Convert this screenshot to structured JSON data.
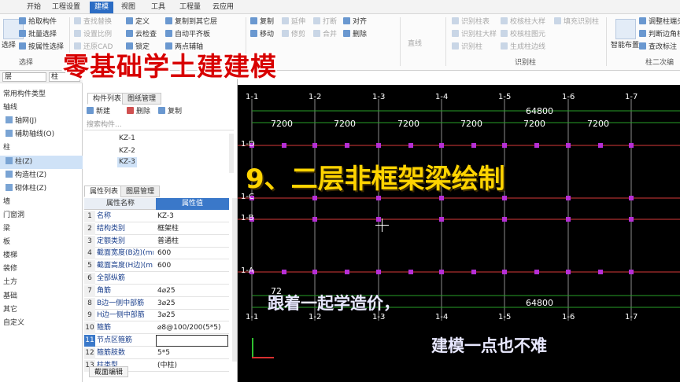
{
  "menu_tabs": [
    "开始",
    "工程设置",
    "建模",
    "视图",
    "工具",
    "工程量",
    "云应用"
  ],
  "active_tab": "建模",
  "ribbon": {
    "select_big": "选择",
    "select_items": [
      "拾取构件",
      "批量选择",
      "按属性选择"
    ],
    "select_group": "选择",
    "g2": [
      "查找替换",
      "设置比例",
      "还原CAD"
    ],
    "g3": [
      "定义",
      "云检查",
      "锁定"
    ],
    "g4": [
      "复制到其它层",
      "自动平齐板",
      "两点辅轴"
    ],
    "g5": [
      "复制",
      "移动"
    ],
    "g5b": [
      "延伸",
      "修剪"
    ],
    "g6": [
      "打断",
      "合并"
    ],
    "g7": [
      "对齐",
      "删除"
    ],
    "g8": [
      "直线"
    ],
    "g9": [
      "识别柱表",
      "识别柱大样",
      "识别柱"
    ],
    "g10": [
      "校核柱大样",
      "校核柱图元",
      "生成柱边线"
    ],
    "g11": [
      "填充识别柱"
    ],
    "recog_group": "识别柱",
    "smart": "智能布置",
    "g12": [
      "调整柱端头",
      "判断边角柱",
      "查改标注"
    ],
    "col2d_group": "柱二次编"
  },
  "layer_select": "层",
  "type_select": "柱",
  "left_panel": {
    "items": [
      {
        "label": "常用构件类型",
        "sub": false,
        "sel": false
      },
      {
        "label": "轴线",
        "sub": false,
        "sel": false
      },
      {
        "label": "轴网(J)",
        "sub": true,
        "sel": false
      },
      {
        "label": "辅助轴线(O)",
        "sub": true,
        "sel": false
      },
      {
        "label": "柱",
        "sub": false,
        "sel": false
      },
      {
        "label": "柱(Z)",
        "sub": true,
        "sel": true
      },
      {
        "label": "构造柱(Z)",
        "sub": true,
        "sel": false
      },
      {
        "label": "砌体柱(Z)",
        "sub": true,
        "sel": false
      },
      {
        "label": "墙",
        "sub": false,
        "sel": false
      },
      {
        "label": "门窗洞",
        "sub": false,
        "sel": false
      },
      {
        "label": "梁",
        "sub": false,
        "sel": false
      },
      {
        "label": "板",
        "sub": false,
        "sel": false
      },
      {
        "label": "楼梯",
        "sub": false,
        "sel": false
      },
      {
        "label": "装修",
        "sub": false,
        "sel": false
      },
      {
        "label": "土方",
        "sub": false,
        "sel": false
      },
      {
        "label": "基础",
        "sub": false,
        "sel": false
      },
      {
        "label": "其它",
        "sub": false,
        "sel": false
      },
      {
        "label": "自定义",
        "sub": false,
        "sel": false
      }
    ]
  },
  "component_panel": {
    "tabs": [
      "构件列表",
      "图纸管理"
    ],
    "toolbar": [
      "新建",
      "删除",
      "复制"
    ],
    "search_placeholder": "搜索构件...",
    "items": [
      "KZ-1",
      "KZ-2",
      "KZ-3"
    ],
    "selected": "KZ-3"
  },
  "property_panel": {
    "tabs": [
      "属性列表",
      "图层管理"
    ],
    "col_name": "属性名称",
    "col_value": "属性值",
    "rows": [
      {
        "n": "1",
        "name": "名称",
        "value": "KZ-3"
      },
      {
        "n": "2",
        "name": "结构类别",
        "value": "框架柱"
      },
      {
        "n": "3",
        "name": "定额类别",
        "value": "普通柱"
      },
      {
        "n": "4",
        "name": "截面宽度(B边)(mm)",
        "value": "600"
      },
      {
        "n": "5",
        "name": "截面高度(H边)(mm)",
        "value": "600"
      },
      {
        "n": "6",
        "name": "全部纵筋",
        "value": ""
      },
      {
        "n": "7",
        "name": "角筋",
        "value": "4⌀25"
      },
      {
        "n": "8",
        "name": "B边一侧中部筋",
        "value": "3⌀25"
      },
      {
        "n": "9",
        "name": "H边一侧中部筋",
        "value": "3⌀25"
      },
      {
        "n": "10",
        "name": "箍筋",
        "value": "⌀8@100/200(5*5)"
      },
      {
        "n": "11",
        "name": "节点区箍筋",
        "value": ""
      },
      {
        "n": "12",
        "name": "箍筋肢数",
        "value": "5*5"
      },
      {
        "n": "13",
        "name": "柱类型",
        "value": "(中柱)"
      }
    ],
    "bottom_btn": "截面编辑"
  },
  "canvas": {
    "top_axes": [
      "1-1",
      "1-2",
      "1-3",
      "1-4",
      "1-5",
      "1-6",
      "1-7"
    ],
    "bottom_axes": [
      "1-1",
      "1-2",
      "1-3",
      "1-4",
      "1-5",
      "1-6",
      "1-7"
    ],
    "side_axes": [
      "1-D",
      "1-C",
      "1-B",
      "1-A"
    ],
    "total_dim": "64800",
    "total_dim_bottom": "64800",
    "span_dims": [
      "7200",
      "7200",
      "7200",
      "7200",
      "7200",
      "7200"
    ],
    "bottom_first_span": "72"
  },
  "overlays": {
    "brand": "零基础学土建建模",
    "lesson": "9、二层非框架梁绘制",
    "line1": "跟着一起学造价，",
    "line2": "建模一点也不难"
  }
}
